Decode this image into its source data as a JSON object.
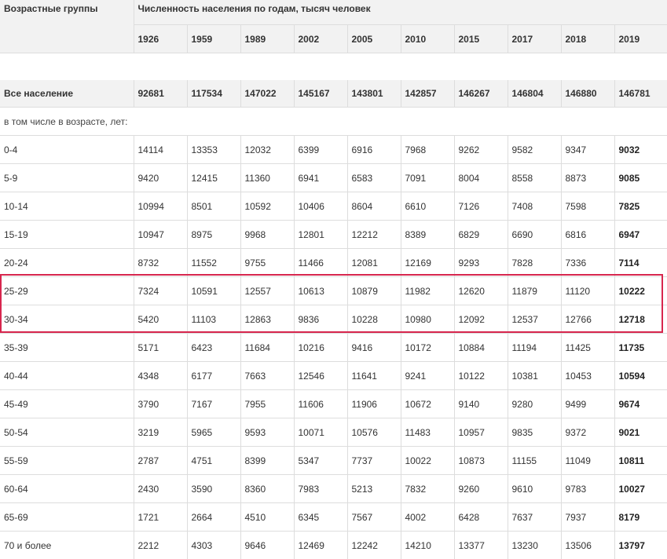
{
  "header": {
    "group_label": "Возрастные группы",
    "title": "Численность населения по годам, тысяч человек",
    "years": [
      "1926",
      "1959",
      "1989",
      "2002",
      "2005",
      "2010",
      "2015",
      "2017",
      "2018",
      "2019"
    ]
  },
  "total": {
    "label": "Все население",
    "values": [
      "92681",
      "117534",
      "147022",
      "145167",
      "143801",
      "142857",
      "146267",
      "146804",
      "146880",
      "146781"
    ]
  },
  "subheader": "в том числе в возрасте,  лет:",
  "rows": [
    {
      "label": "0-4",
      "values": [
        "14114",
        "13353",
        "12032",
        "6399",
        "6916",
        "7968",
        "9262",
        "9582",
        "9347",
        "9032"
      ]
    },
    {
      "label": "5-9",
      "values": [
        "9420",
        "12415",
        "11360",
        "6941",
        "6583",
        "7091",
        "8004",
        "8558",
        "8873",
        "9085"
      ]
    },
    {
      "label": "10-14",
      "values": [
        "10994",
        "8501",
        "10592",
        "10406",
        "8604",
        "6610",
        "7126",
        "7408",
        "7598",
        "7825"
      ]
    },
    {
      "label": "15-19",
      "values": [
        "10947",
        "8975",
        "9968",
        "12801",
        "12212",
        "8389",
        "6829",
        "6690",
        "6816",
        "6947"
      ]
    },
    {
      "label": "20-24",
      "values": [
        "8732",
        "11552",
        "9755",
        "11466",
        "12081",
        "12169",
        "9293",
        "7828",
        "7336",
        "7114"
      ]
    },
    {
      "label": "25-29",
      "values": [
        "7324",
        "10591",
        "12557",
        "10613",
        "10879",
        "11982",
        "12620",
        "11879",
        "11120",
        "10222"
      ]
    },
    {
      "label": "30-34",
      "values": [
        "5420",
        "11103",
        "12863",
        "9836",
        "10228",
        "10980",
        "12092",
        "12537",
        "12766",
        "12718"
      ]
    },
    {
      "label": "35-39",
      "values": [
        "5171",
        "6423",
        "11684",
        "10216",
        "9416",
        "10172",
        "10884",
        "11194",
        "11425",
        "11735"
      ]
    },
    {
      "label": "40-44",
      "values": [
        "4348",
        "6177",
        "7663",
        "12546",
        "11641",
        "9241",
        "10122",
        "10381",
        "10453",
        "10594"
      ]
    },
    {
      "label": "45-49",
      "values": [
        "3790",
        "7167",
        "7955",
        "11606",
        "11906",
        "10672",
        "9140",
        "9280",
        "9499",
        "9674"
      ]
    },
    {
      "label": "50-54",
      "values": [
        "3219",
        "5965",
        "9593",
        "10071",
        "10576",
        "11483",
        "10957",
        "9835",
        "9372",
        "9021"
      ]
    },
    {
      "label": "55-59",
      "values": [
        "2787",
        "4751",
        "8399",
        "5347",
        "7737",
        "10022",
        "10873",
        "11155",
        "11049",
        "10811"
      ]
    },
    {
      "label": "60-64",
      "values": [
        "2430",
        "3590",
        "8360",
        "7983",
        "5213",
        "7832",
        "9260",
        "9610",
        "9783",
        "10027"
      ]
    },
    {
      "label": "65-69",
      "values": [
        "1721",
        "2664",
        "4510",
        "6345",
        "7567",
        "4002",
        "6428",
        "7637",
        "7937",
        "8179"
      ]
    },
    {
      "label": "70 и более",
      "values": [
        "2212",
        "4303",
        "9646",
        "12469",
        "12242",
        "14210",
        "13377",
        "13230",
        "13506",
        "13797"
      ]
    }
  ],
  "highlight_color": "#d7264e"
}
